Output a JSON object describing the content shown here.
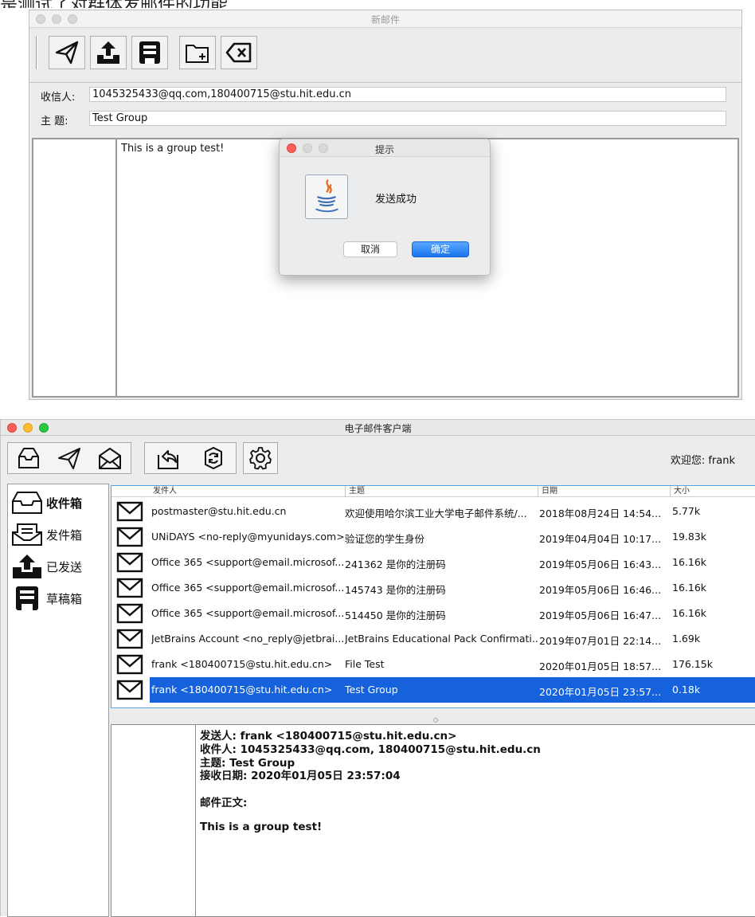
{
  "caption": "是测试了对群体发邮件的功能",
  "compose": {
    "title": "新邮件",
    "recipients_label": "收信人:",
    "recipients_value": "1045325433@qq.com,180400715@stu.hit.edu.cn",
    "subject_label": "主 题:",
    "subject_value": "Test Group",
    "body_text": "This is a group test!",
    "toolbar_icons": [
      "send-icon",
      "upload-icon",
      "save-draft-icon",
      "add-attachment-icon",
      "clear-icon"
    ]
  },
  "dialog": {
    "title": "提示",
    "message": "发送成功",
    "cancel_label": "取消",
    "ok_label": "确定"
  },
  "client": {
    "title": "电子邮件客户端",
    "welcome": "欢迎您: frank",
    "sidebar": [
      {
        "label": "收件箱",
        "icon": "inbox-icon"
      },
      {
        "label": "发件箱",
        "icon": "outbox-icon"
      },
      {
        "label": "已发送",
        "icon": "sent-icon"
      },
      {
        "label": "草稿箱",
        "icon": "drafts-icon"
      }
    ],
    "columns": [
      "发件人",
      "主题",
      "日期",
      "大小"
    ],
    "messages": [
      {
        "from": "postmaster@stu.hit.edu.cn",
        "subject": "欢迎使用哈尔滨工业大学电子邮件系统/...",
        "date": "2018年08月24日 14:54...",
        "size": "5.77k"
      },
      {
        "from": "UNiDAYS <no-reply@myunidays.com>",
        "subject": "验证您的学生身份",
        "date": "2019年04月04日 10:17...",
        "size": "19.83k"
      },
      {
        "from": "Office 365 <support@email.microsof...",
        "subject": "241362 是你的注册码",
        "date": "2019年05月06日 16:43...",
        "size": "16.16k"
      },
      {
        "from": "Office 365 <support@email.microsof...",
        "subject": "145743 是你的注册码",
        "date": "2019年05月06日 16:46...",
        "size": "16.16k"
      },
      {
        "from": "Office 365 <support@email.microsof...",
        "subject": "514450 是你的注册码",
        "date": "2019年05月06日 16:47...",
        "size": "16.16k"
      },
      {
        "from": "JetBrains Account <no_reply@jetbrai...",
        "subject": "JetBrains Educational Pack Confirmati...",
        "date": "2019年07月01日 22:14...",
        "size": "1.69k"
      },
      {
        "from": "frank <180400715@stu.hit.edu.cn>",
        "subject": "File Test",
        "date": "2020年01月05日 18:57...",
        "size": "176.15k"
      },
      {
        "from": "frank <180400715@stu.hit.edu.cn>",
        "subject": "Test Group",
        "date": "2020年01月05日 23:57...",
        "size": "0.18k",
        "selected": true
      }
    ],
    "detail": {
      "from_line": "发送人:   frank <180400715@stu.hit.edu.cn>",
      "to_line": "收件人:   1045325433@qq.com, 180400715@stu.hit.edu.cn",
      "subject_line": "主题:   Test Group",
      "date_line": "接收日期:   2020年01月05日 23:57:04",
      "body_label": "邮件正文:",
      "body_text": "This is a group test!"
    }
  }
}
